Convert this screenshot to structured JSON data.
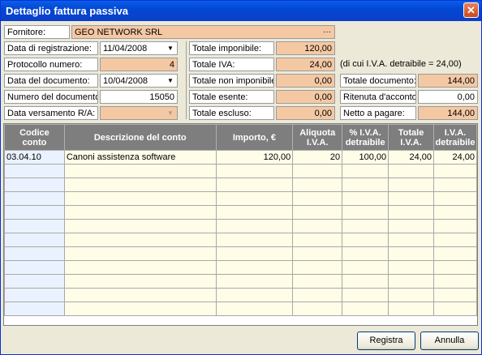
{
  "window": {
    "title": "Dettaglio fattura passiva",
    "close_icon": "close-icon"
  },
  "fornitore": {
    "label": "Fornitore:",
    "value": "GEO NETWORK SRL",
    "button": "···"
  },
  "left_fields": [
    {
      "label": "Data di registrazione:",
      "value": "11/04/2008"
    },
    {
      "label": "Protocollo numero:",
      "value": "4"
    },
    {
      "label": "Data del documento:",
      "value": "10/04/2008"
    },
    {
      "label": "Numero del documento:",
      "value": "15050"
    },
    {
      "label": "Data versamento R/A:",
      "value": ""
    }
  ],
  "mid_fields": [
    {
      "label": "Totale imponibile:",
      "value": "120,00"
    },
    {
      "label": "Totale IVA:",
      "value": "24,00"
    },
    {
      "label": "Totale non imponibile:",
      "value": "0,00"
    },
    {
      "label": "Totale esente:",
      "value": "0,00"
    },
    {
      "label": "Totale escluso:",
      "value": "0,00"
    }
  ],
  "iva_note": "(di cui I.V.A. detraibile = 24,00)",
  "right_fields": [
    {
      "label": "Totale documento:",
      "value": "144,00"
    },
    {
      "label": "Ritenuta d'acconto:",
      "value": "0,00"
    },
    {
      "label": "Netto a pagare:",
      "value": "144,00"
    }
  ],
  "table": {
    "columns": [
      {
        "line1": "Codice",
        "line2": "conto"
      },
      {
        "line1": "Descrizione del conto",
        "line2": ""
      },
      {
        "line1": "Importo, €",
        "line2": ""
      },
      {
        "line1": "Aliquota",
        "line2": "I.V.A."
      },
      {
        "line1": "% I.V.A.",
        "line2": "detraibile"
      },
      {
        "line1": "Totale",
        "line2": "I.V.A."
      },
      {
        "line1": "I.V.A.",
        "line2": "detraibile"
      }
    ],
    "rows": [
      [
        "03.04.10",
        "Canoni assistenza software",
        "120,00",
        "20",
        "100,00",
        "24,00",
        "24,00"
      ]
    ]
  },
  "buttons": {
    "registra": "Registra",
    "annulla": "Annulla"
  }
}
